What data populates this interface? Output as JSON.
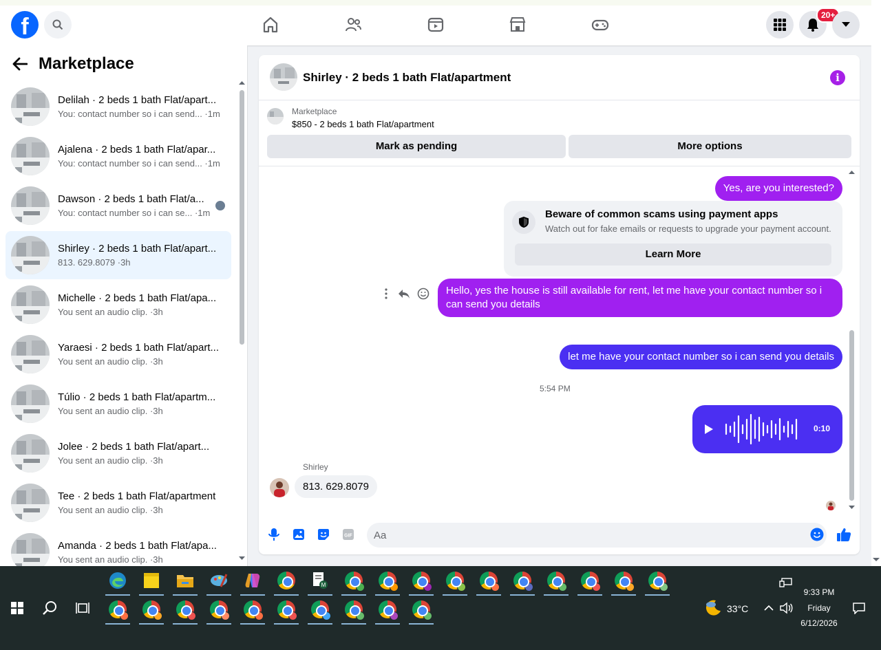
{
  "topnav": {
    "logo": "f",
    "notification_badge": "20+"
  },
  "sidebar": {
    "title": "Marketplace",
    "conversations": [
      {
        "name": "Delilah · 2 beds 1 bath Flat/apart...",
        "preview": "You: contact number so i can send... ·1m"
      },
      {
        "name": "Ajalena · 2 beds 1 bath Flat/apar...",
        "preview": "You: contact number so i can send... ·1m"
      },
      {
        "name": "Dawson · 2 beds 1 bath Flat/a...",
        "preview": "You: contact number so i can se... ·1m"
      },
      {
        "name": "Shirley · 2 beds 1 bath Flat/apart...",
        "preview": "813. 629.8079 ·3h"
      },
      {
        "name": "Michelle · 2 beds 1 bath Flat/apa...",
        "preview": "You sent an audio clip. ·3h"
      },
      {
        "name": "Yaraesi · 2 beds 1 bath Flat/apart...",
        "preview": "You sent an audio clip. ·3h"
      },
      {
        "name": "Túlio · 2 beds 1 bath Flat/apartm...",
        "preview": "You sent an audio clip. ·3h"
      },
      {
        "name": "Jolee · 2 beds 1 bath Flat/apart...",
        "preview": "You sent an audio clip. ·3h"
      },
      {
        "name": "Tee · 2 beds 1 bath Flat/apartment",
        "preview": "You sent an audio clip. ·3h"
      },
      {
        "name": "Amanda · 2 beds 1 bath Flat/apa...",
        "preview": "You sent an audio clip. ·3h"
      }
    ]
  },
  "chat": {
    "title": "Shirley · 2 beds 1 bath Flat/apartment",
    "listing": {
      "source": "Marketplace",
      "price_title": "$850 - 2 beds 1 bath Flat/apartment",
      "mark_pending": "Mark as pending",
      "more_options": "More options"
    },
    "messages": {
      "msg1": "Yes, are you interested?",
      "scam_title": "Beware of common scams using payment apps",
      "scam_sub": "Watch out for fake emails or requests to upgrade your payment account.",
      "learn_more": "Learn More",
      "msg2": "Hello, yes the house is still available for rent, let me have your contact number so i can send you details",
      "msg3": "let me have your contact number so i can send you details",
      "timestamp": "5:54 PM",
      "audio_duration": "0:10",
      "sender": "Shirley",
      "incoming": "813. 629.8079"
    },
    "composer": {
      "placeholder": "Aa"
    }
  },
  "taskbar": {
    "weather": "33°C",
    "time": "9:33 PM",
    "day": "Friday",
    "date": "6/12/2026"
  },
  "colors": {
    "accent_purple": "#a020f0",
    "accent_blue": "#4b2ff2",
    "fb_blue": "#0866ff"
  }
}
